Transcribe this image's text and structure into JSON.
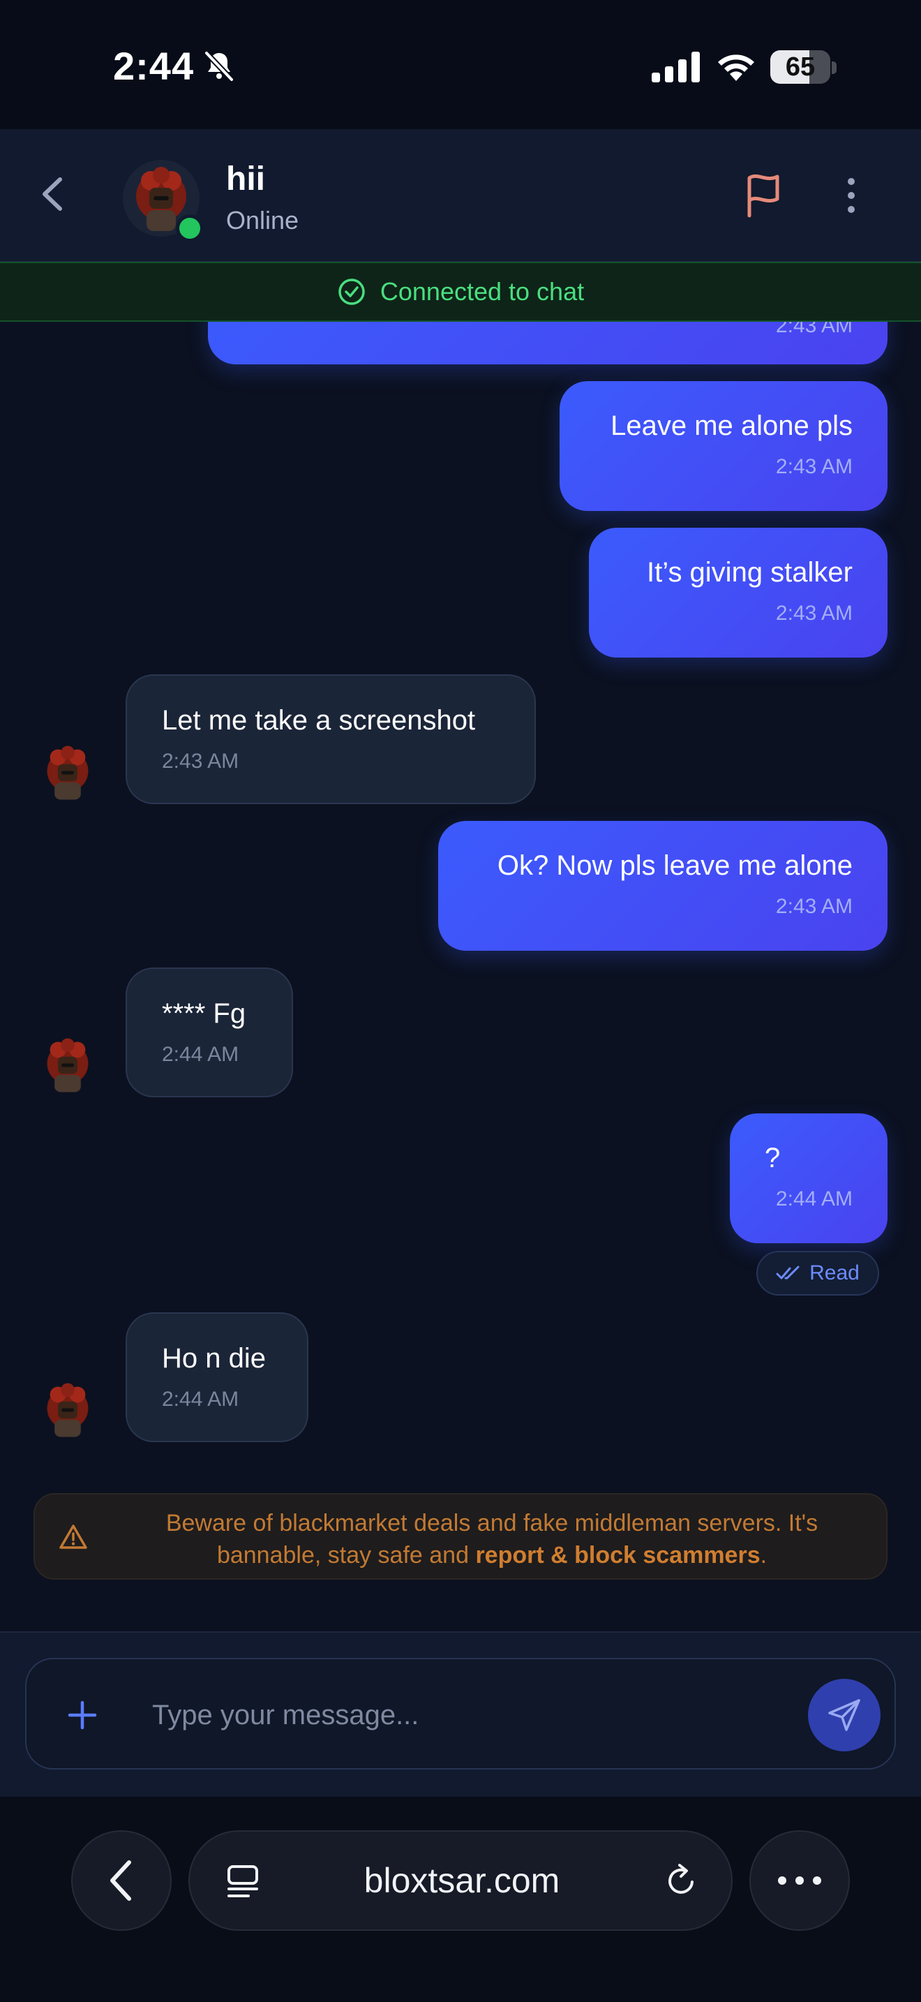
{
  "status_bar": {
    "time": "2:44",
    "battery": "65",
    "battery_level": 0.65
  },
  "header": {
    "name": "hii",
    "status": "Online"
  },
  "connection": {
    "text": "Connected to chat"
  },
  "messages": [
    {
      "dir": "out",
      "text": "",
      "time": "2:43 AM"
    },
    {
      "dir": "out",
      "text": "Leave me alone pls",
      "time": "2:43 AM"
    },
    {
      "dir": "out",
      "text": "It’s giving stalker",
      "time": "2:43 AM"
    },
    {
      "dir": "in",
      "text": "Let me take a screenshot",
      "time": "2:43 AM"
    },
    {
      "dir": "out",
      "text": "Ok? Now pls leave me alone",
      "time": "2:43 AM"
    },
    {
      "dir": "in",
      "text": "**** Fg",
      "time": "2:44 AM"
    },
    {
      "dir": "out",
      "text": "?",
      "time": "2:44 AM"
    },
    {
      "dir": "in",
      "text": "Ho n die",
      "time": "2:44 AM"
    }
  ],
  "read_receipt": "Read",
  "warning": {
    "text_before": "Beware of blackmarket deals and fake middleman servers. It's bannable, stay safe and ",
    "text_bold": "report & block scammers",
    "text_after": "."
  },
  "composer": {
    "placeholder": "Type your message..."
  },
  "browser": {
    "url": "bloxtsar.com"
  },
  "colors": {
    "outgoing_bubble": "#3b5bfd",
    "incoming_bubble": "#1b2538",
    "online": "#22c55e",
    "connected": "#4ade80",
    "warning": "#c27a33"
  }
}
